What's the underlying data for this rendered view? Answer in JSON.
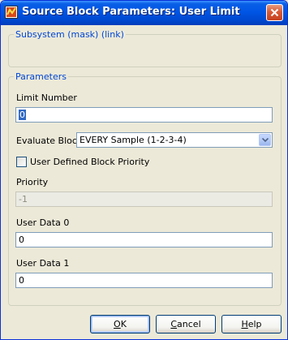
{
  "window": {
    "title": "Source Block Parameters: User Limit"
  },
  "subsystem_group": {
    "legend": "Subsystem (mask) (link)"
  },
  "parameters_group": {
    "legend": "Parameters",
    "limit_number": {
      "label": "Limit Number",
      "value": "0"
    },
    "evaluate_block": {
      "label": "Evaluate Block",
      "selected": "EVERY Sample (1-2-3-4)"
    },
    "user_defined_priority": {
      "label": "User Defined Block Priority",
      "checked": false
    },
    "priority": {
      "label": "Priority",
      "value": "-1"
    },
    "user_data_0": {
      "label": "User Data 0",
      "value": "0"
    },
    "user_data_1": {
      "label": "User Data 1",
      "value": "0"
    }
  },
  "buttons": {
    "ok": {
      "label_ul": "O",
      "label_rest": "K"
    },
    "cancel": {
      "label_ul": "C",
      "label_rest": "ancel"
    },
    "help": {
      "label_ul": "H",
      "label_rest": "elp"
    }
  },
  "colors": {
    "title_bar": "#0055e5",
    "group_legend": "#0046d5",
    "dialog_background": "#ece9d8",
    "selection": "#316ac5"
  },
  "icons": {
    "app": "simulink-block-icon",
    "close": "close-icon",
    "dropdown": "chevron-down-icon"
  }
}
